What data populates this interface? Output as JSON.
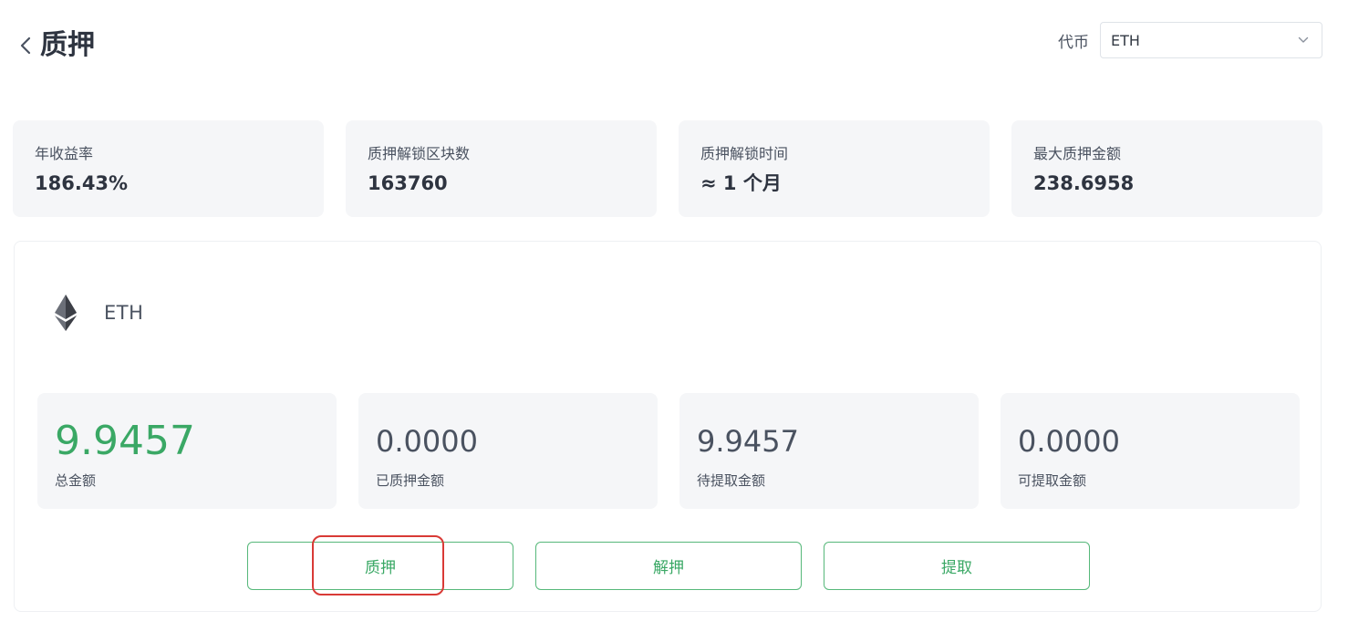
{
  "header": {
    "title": "质押",
    "token_label": "代币",
    "token_selected": "ETH"
  },
  "stats": [
    {
      "label": "年收益率",
      "value": "186.43%"
    },
    {
      "label": "质押解锁区块数",
      "value": "163760"
    },
    {
      "label": "质押解锁时间",
      "value": "≈ 1 个月"
    },
    {
      "label": "最大质押金额",
      "value": "238.6958"
    }
  ],
  "asset": {
    "name": "ETH",
    "balances": [
      {
        "value": "9.9457",
        "label": "总金额"
      },
      {
        "value": "0.0000",
        "label": "已质押金额"
      },
      {
        "value": "9.9457",
        "label": "待提取金额"
      },
      {
        "value": "0.0000",
        "label": "可提取金额"
      }
    ]
  },
  "actions": {
    "stake_label": "质押",
    "unstake_label": "解押",
    "withdraw_label": "提取"
  },
  "colors": {
    "accent": "#3aa865",
    "highlight": "#d93a36",
    "card_bg": "#f5f6f8"
  },
  "icons": {
    "back": "chevron-left-icon",
    "dropdown": "chevron-down-icon",
    "asset": "ethereum-icon"
  }
}
